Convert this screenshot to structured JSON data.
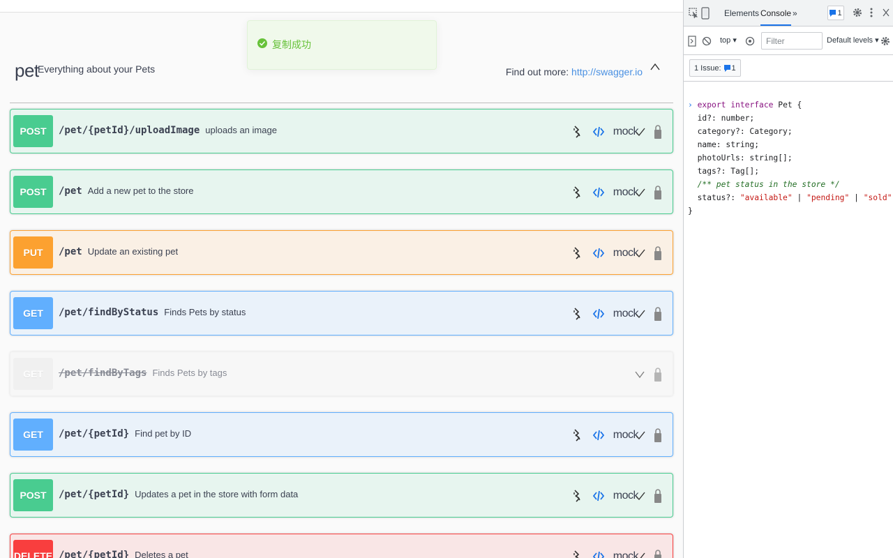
{
  "toast": {
    "message": "复制成功"
  },
  "tag": {
    "name": "pet",
    "description": "Everything about your Pets",
    "find_more_label": "Find out more:",
    "find_more_link": "http://swagger.io"
  },
  "operations": [
    {
      "method": "POST",
      "path": "/pet/{petId}/uploadImage",
      "summary": "uploads an image",
      "kind": "post",
      "deprecated": false
    },
    {
      "method": "POST",
      "path": "/pet",
      "summary": "Add a new pet to the store",
      "kind": "post",
      "deprecated": false
    },
    {
      "method": "PUT",
      "path": "/pet",
      "summary": "Update an existing pet",
      "kind": "put",
      "deprecated": false
    },
    {
      "method": "GET",
      "path": "/pet/findByStatus",
      "summary": "Finds Pets by status",
      "kind": "get",
      "deprecated": false
    },
    {
      "method": "GET",
      "path": "/pet/findByTags",
      "summary": "Finds Pets by tags",
      "kind": "get",
      "deprecated": true
    },
    {
      "method": "GET",
      "path": "/pet/{petId}",
      "summary": "Find pet by ID",
      "kind": "get",
      "deprecated": false
    },
    {
      "method": "POST",
      "path": "/pet/{petId}",
      "summary": "Updates a pet in the store with form data",
      "kind": "post",
      "deprecated": false
    },
    {
      "method": "DELETE",
      "path": "/pet/{petId}",
      "summary": "Deletes a pet",
      "kind": "delete",
      "deprecated": false
    }
  ],
  "mock_label": "mock",
  "devtools": {
    "tabs": [
      "Elements",
      "Console"
    ],
    "active_tab": "Console",
    "more_tabs": "»",
    "issues_count_badge": "1",
    "context": "top",
    "filter_placeholder": "Filter",
    "levels": "Default levels",
    "issues_button": "1 Issue:",
    "issues_button_count": "1",
    "console_lines": [
      "export interface Pet {",
      "  id?: number;",
      "  category?: Category;",
      "  name: string;",
      "  photoUrls: string[];",
      "  tags?: Tag[];",
      "  /** pet status in the store */",
      "  status?: \"available\" | \"pending\" | \"sold\";",
      "}"
    ]
  },
  "colors": {
    "post": "#49cc90",
    "put": "#fca130",
    "get": "#61affe",
    "delete": "#f93e3e",
    "toast_text": "#67c23a",
    "accent": "#1a73e8"
  }
}
